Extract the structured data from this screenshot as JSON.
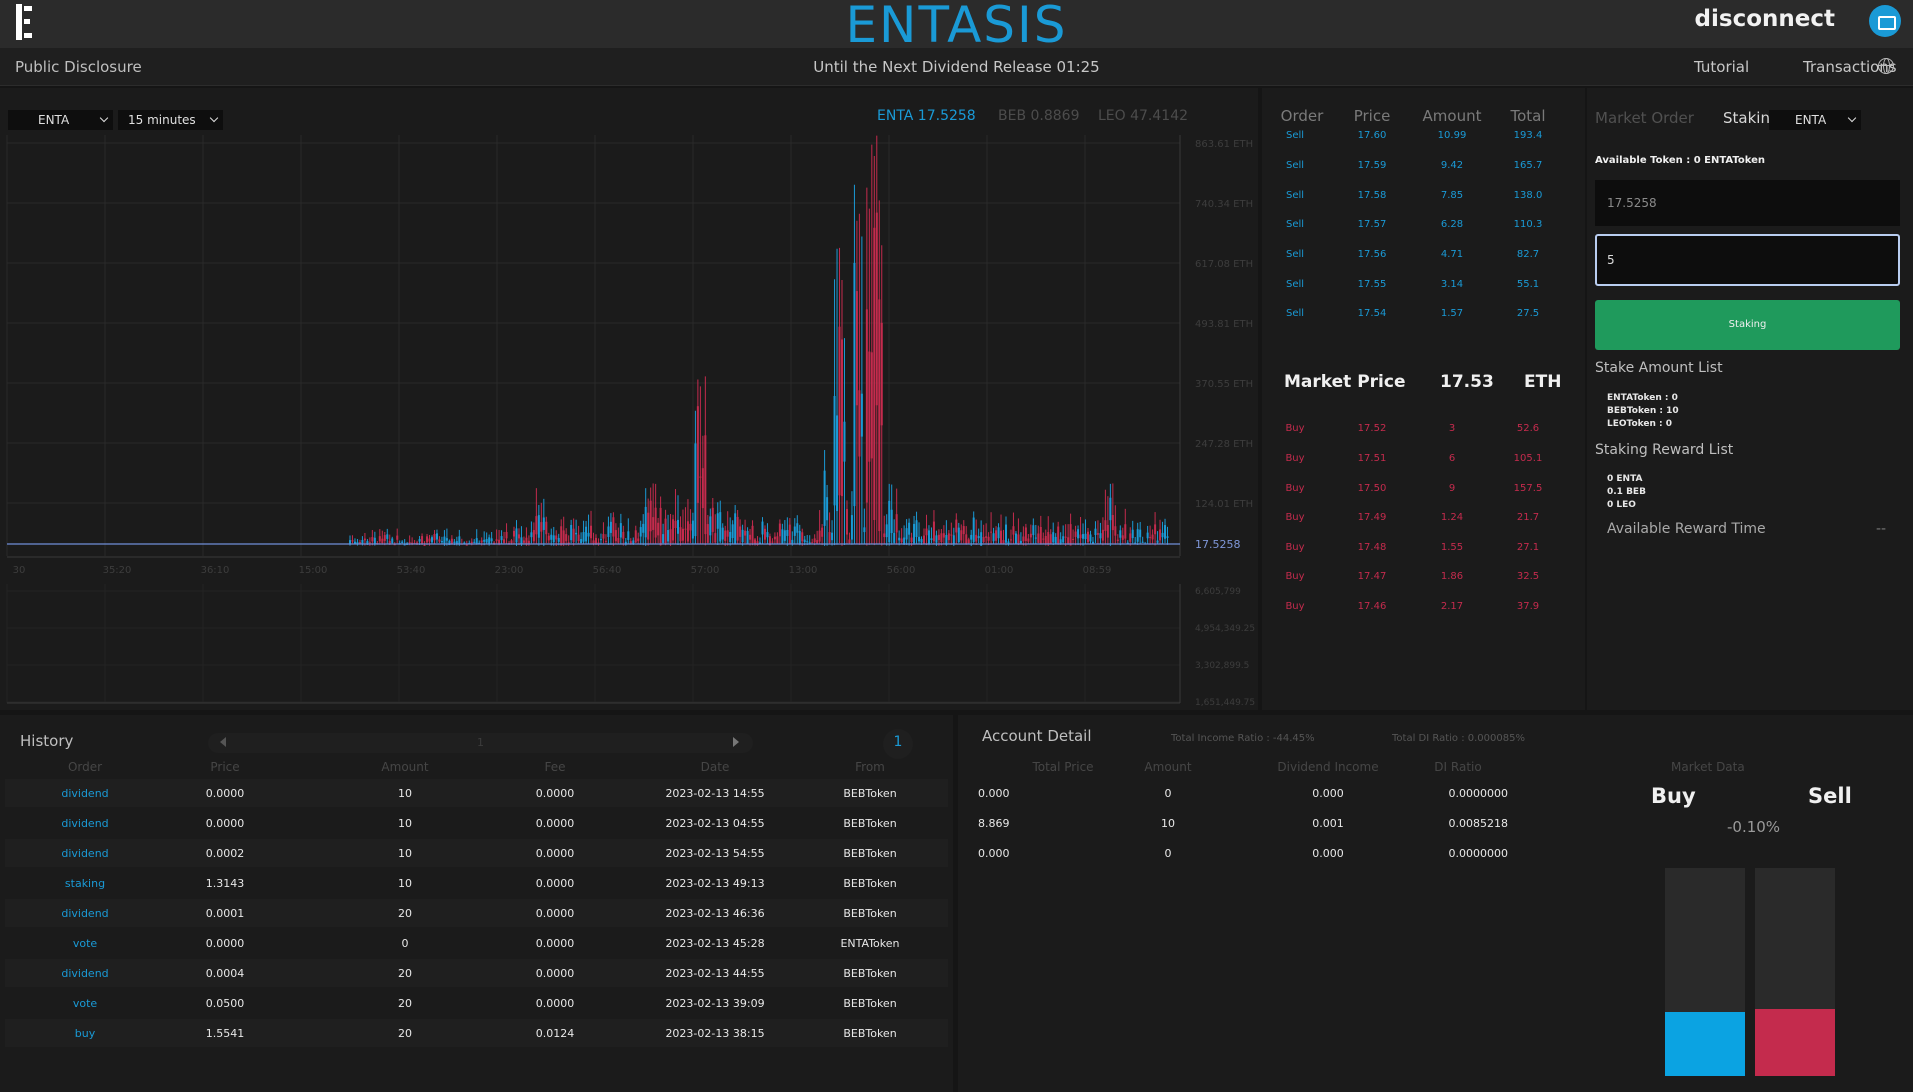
{
  "header": {
    "brand": "ENTASIS",
    "disconnect_label": "disconnect",
    "public_disclosure": "Public Disclosure",
    "countdown": "Until the Next Dividend Release 01:25",
    "tutorial": "Tutorial",
    "transactions": "Transactions"
  },
  "chart_panel": {
    "symbol": "ENTA",
    "interval": "15 minutes",
    "tickers": [
      {
        "label": "ENTA 17.5258"
      },
      {
        "label": "BEB 0.8869"
      },
      {
        "label": "LEO 47.4142"
      }
    ],
    "current_price_label": "17.5258"
  },
  "chart_data": {
    "type": "candlestick",
    "price_axis_ticks": [
      "863.61 ETH",
      "740.34 ETH",
      "617.08 ETH",
      "493.81 ETH",
      "370.55 ETH",
      "247.28 ETH",
      "124.01 ETH"
    ],
    "volume_axis_ticks": [
      "6,605,799",
      "4,954,349.25",
      "3,302,899.5",
      "1,651,449.75"
    ],
    "time_ticks": [
      "30",
      "35:20",
      "36:10",
      "15:00",
      "53:40",
      "23:00",
      "56:40",
      "57:00",
      "13:00",
      "56:00",
      "01:00",
      "08:59"
    ],
    "ylim": [
      0,
      863.61
    ],
    "current_price": 17.5258,
    "colors": {
      "up": "#1a9ad6",
      "down": "#c42b4d"
    }
  },
  "order_book": {
    "headers": [
      "Order",
      "Price",
      "Amount",
      "Total"
    ],
    "sells": [
      {
        "order": "Sell",
        "price": "17.60",
        "amount": "10.99",
        "total": "193.4"
      },
      {
        "order": "Sell",
        "price": "17.59",
        "amount": "9.42",
        "total": "165.7"
      },
      {
        "order": "Sell",
        "price": "17.58",
        "amount": "7.85",
        "total": "138.0"
      },
      {
        "order": "Sell",
        "price": "17.57",
        "amount": "6.28",
        "total": "110.3"
      },
      {
        "order": "Sell",
        "price": "17.56",
        "amount": "4.71",
        "total": "82.7"
      },
      {
        "order": "Sell",
        "price": "17.55",
        "amount": "3.14",
        "total": "55.1"
      },
      {
        "order": "Sell",
        "price": "17.54",
        "amount": "1.57",
        "total": "27.5"
      }
    ],
    "market_price_label": "Market Price",
    "market_price": "17.53",
    "market_unit": "ETH",
    "buys": [
      {
        "order": "Buy",
        "price": "17.52",
        "amount": "3",
        "total": "52.6"
      },
      {
        "order": "Buy",
        "price": "17.51",
        "amount": "6",
        "total": "105.1"
      },
      {
        "order": "Buy",
        "price": "17.50",
        "amount": "9",
        "total": "157.5"
      },
      {
        "order": "Buy",
        "price": "17.49",
        "amount": "1.24",
        "total": "21.7"
      },
      {
        "order": "Buy",
        "price": "17.48",
        "amount": "1.55",
        "total": "27.1"
      },
      {
        "order": "Buy",
        "price": "17.47",
        "amount": "1.86",
        "total": "32.5"
      },
      {
        "order": "Buy",
        "price": "17.46",
        "amount": "2.17",
        "total": "37.9"
      }
    ]
  },
  "staking": {
    "tab_market": "Market Order",
    "tab_staking": "Staking",
    "token": "ENTA",
    "available_token": "Available Token : 0 ENTAToken",
    "price_value": "17.5258",
    "amount_value": "5",
    "button": "Staking",
    "stake_amount_title": "Stake Amount List",
    "stake_amounts": [
      "ENTAToken : 0",
      "BEBToken : 10",
      "LEOToken : 0"
    ],
    "reward_title": "Staking Reward List",
    "rewards": [
      "0 ENTA",
      "0.1 BEB",
      "0 LEO"
    ],
    "available_reward_label": "Available Reward Time",
    "available_reward_value": "--"
  },
  "history": {
    "title": "History",
    "page": "1",
    "pager_center": "1",
    "headers": [
      "Order",
      "Price",
      "Amount",
      "Fee",
      "Date",
      "From"
    ],
    "rows": [
      {
        "order": "dividend",
        "price": "0.0000",
        "amount": "10",
        "fee": "0.0000",
        "date": "2023-02-13 14:55",
        "from": "BEBToken"
      },
      {
        "order": "dividend",
        "price": "0.0000",
        "amount": "10",
        "fee": "0.0000",
        "date": "2023-02-13 04:55",
        "from": "BEBToken"
      },
      {
        "order": "dividend",
        "price": "0.0002",
        "amount": "10",
        "fee": "0.0000",
        "date": "2023-02-13 54:55",
        "from": "BEBToken"
      },
      {
        "order": "staking",
        "price": "1.3143",
        "amount": "10",
        "fee": "0.0000",
        "date": "2023-02-13 49:13",
        "from": "BEBToken"
      },
      {
        "order": "dividend",
        "price": "0.0001",
        "amount": "20",
        "fee": "0.0000",
        "date": "2023-02-13 46:36",
        "from": "BEBToken"
      },
      {
        "order": "vote",
        "price": "0.0000",
        "amount": "0",
        "fee": "0.0000",
        "date": "2023-02-13 45:28",
        "from": "ENTAToken"
      },
      {
        "order": "dividend",
        "price": "0.0004",
        "amount": "20",
        "fee": "0.0000",
        "date": "2023-02-13 44:55",
        "from": "BEBToken"
      },
      {
        "order": "vote",
        "price": "0.0500",
        "amount": "20",
        "fee": "0.0000",
        "date": "2023-02-13 39:09",
        "from": "BEBToken"
      },
      {
        "order": "buy",
        "price": "1.5541",
        "amount": "20",
        "fee": "0.0124",
        "date": "2023-02-13 38:15",
        "from": "BEBToken"
      }
    ]
  },
  "account": {
    "title": "Account Detail",
    "total_income_ratio": "Total Income Ratio : -44.45%",
    "total_di_ratio": "Total DI Ratio : 0.000085%",
    "headers": [
      "Total Price",
      "Amount",
      "Dividend Income",
      "DI Ratio"
    ],
    "rows": [
      {
        "total_price": "0.000",
        "amount": "0",
        "dividend_income": "0.000",
        "di_ratio": "0.0000000"
      },
      {
        "total_price": "8.869",
        "amount": "10",
        "dividend_income": "0.001",
        "di_ratio": "0.0085218"
      },
      {
        "total_price": "0.000",
        "amount": "0",
        "dividend_income": "0.000",
        "di_ratio": "0.0000000"
      }
    ],
    "market_data_title": "Market Data",
    "buy_label": "Buy",
    "sell_label": "Sell",
    "change": "-0.10%",
    "buy_ratio": 0.31,
    "sell_ratio": 0.32
  }
}
